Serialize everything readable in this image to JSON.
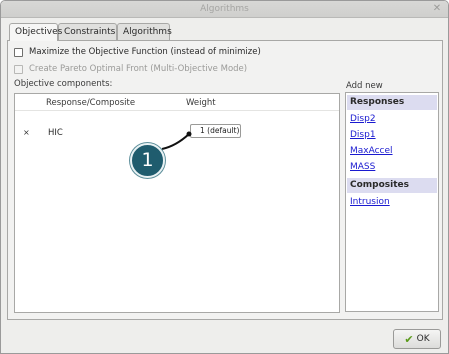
{
  "window": {
    "title": "Algorithms",
    "close_glyph": "✕"
  },
  "tabs": [
    {
      "label": "Objectives",
      "active": true
    },
    {
      "label": "Constraints",
      "active": false
    },
    {
      "label": "Algorithms",
      "active": false
    }
  ],
  "options": {
    "maximize": {
      "label": "Maximize the Objective Function (instead of minimize)",
      "checked": false,
      "enabled": true
    },
    "pareto": {
      "label": "Create Pareto Optimal Front (Multi-Objective Mode)",
      "checked": false,
      "enabled": false
    }
  },
  "objective": {
    "section_label": "Objective components:",
    "columns": [
      "Response/Composite",
      "Weight"
    ],
    "rows": [
      {
        "remove_glyph": "×",
        "name": "HIC",
        "weight": "1 (default)"
      }
    ]
  },
  "callout": {
    "number": "1",
    "color": "#1f5c6e"
  },
  "add_new": {
    "label": "Add new",
    "groups": [
      {
        "heading": "Responses",
        "items": [
          "Disp2",
          "Disp1",
          "MaxAccel",
          "MASS"
        ]
      },
      {
        "heading": "Composites",
        "items": [
          "Intrusion"
        ]
      }
    ]
  },
  "ok_button": {
    "label": "OK",
    "icon": "checkmark-icon",
    "icon_glyph": "✔"
  }
}
